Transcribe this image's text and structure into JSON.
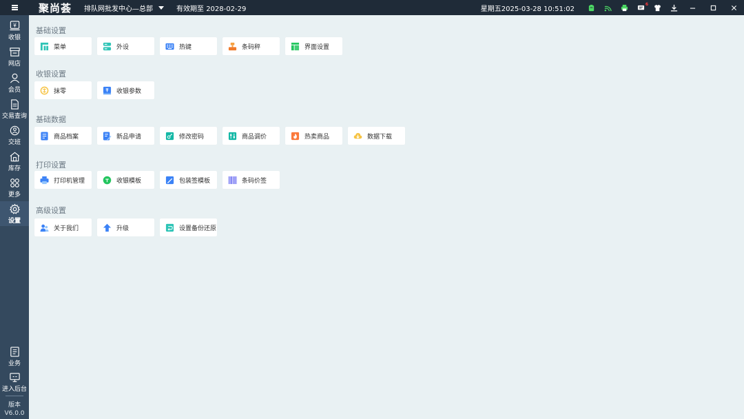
{
  "topbar": {
    "app_name": "聚尚荟",
    "store_name": "排队网批发中心—总部",
    "expiry": "有效期至 2028-02-29",
    "datetime": "星期五2025-03-28 10:51:02",
    "badge": "6"
  },
  "sidebar": {
    "items": [
      {
        "label": "收银"
      },
      {
        "label": "网店"
      },
      {
        "label": "会员"
      },
      {
        "label": "交易查询"
      },
      {
        "label": "交班"
      },
      {
        "label": "库存"
      },
      {
        "label": "更多"
      },
      {
        "label": "设置"
      }
    ],
    "bottom": [
      {
        "label": "业务"
      },
      {
        "label": "进入后台"
      }
    ],
    "version_label": "版本",
    "version": "V6.0.0"
  },
  "sections": [
    {
      "title": "基础设置",
      "tiles": [
        {
          "label": "菜单"
        },
        {
          "label": "外设"
        },
        {
          "label": "热键"
        },
        {
          "label": "条码秤"
        },
        {
          "label": "界面设置"
        }
      ]
    },
    {
      "title": "收银设置",
      "tiles": [
        {
          "label": "抹零"
        },
        {
          "label": "收银参数"
        }
      ]
    },
    {
      "title": "基础数据",
      "tiles": [
        {
          "label": "商品档案"
        },
        {
          "label": "新品申请"
        },
        {
          "label": "修改密码"
        },
        {
          "label": "商品调价"
        },
        {
          "label": "热卖商品"
        },
        {
          "label": "数据下载"
        }
      ]
    },
    {
      "title": "打印设置",
      "tiles": [
        {
          "label": "打印机管理"
        },
        {
          "label": "收银模板"
        },
        {
          "label": "包装签模板"
        },
        {
          "label": "条码价签"
        }
      ]
    },
    {
      "title": "高级设置",
      "tiles": [
        {
          "label": "关于我们"
        },
        {
          "label": "升级"
        },
        {
          "label": "设置备份还原"
        }
      ]
    }
  ],
  "colors": {
    "topbar": "#1f2b38",
    "sidebar": "#34495e",
    "sidebar_active": "#3e5670",
    "background": "#e9f1f3",
    "status_green": "#4cd964"
  }
}
